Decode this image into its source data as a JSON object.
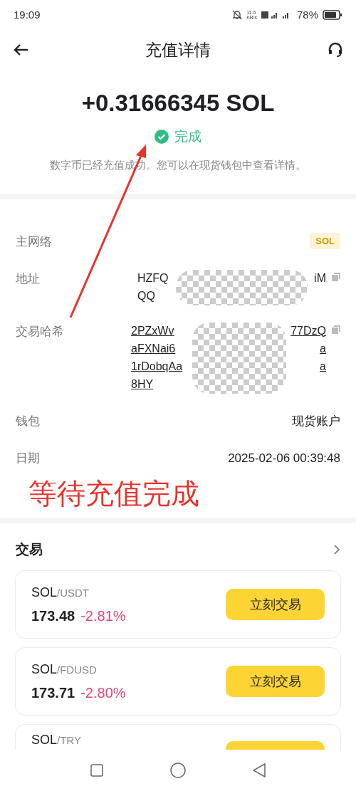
{
  "status_bar": {
    "time": "19:09",
    "net_speed": "11.6",
    "net_unit": "KB/s",
    "battery": "78%"
  },
  "header": {
    "title": "充值详情"
  },
  "summary": {
    "amount": "+0.31666345 SOL",
    "status": "完成",
    "description": "数字币已经充值成功。您可以在现货钱包中查看详情。"
  },
  "details": [
    {
      "kind": "badge",
      "label": "主网络",
      "value": "SOL"
    },
    {
      "kind": "redacted",
      "label": "地址",
      "underlined": false,
      "copyable": true,
      "lines": [
        {
          "start": "HZFQ",
          "end": "iM"
        },
        {
          "start": "QQ"
        }
      ]
    },
    {
      "kind": "redacted",
      "label": "交易哈希",
      "underlined": true,
      "copyable": true,
      "lines": [
        {
          "start": "2PZxWv",
          "end": "77DzQ"
        },
        {
          "start": "aFXNai6",
          "end": "a"
        },
        {
          "start": "1rDobqAa",
          "end": "a"
        },
        {
          "start": "8HY"
        }
      ]
    },
    {
      "kind": "text",
      "label": "钱包",
      "value": "现货账户"
    },
    {
      "kind": "text",
      "label": "日期",
      "value": "2025-02-06 00:39:48"
    }
  ],
  "annotation": {
    "text": "等待充值完成",
    "color": "#e8322c"
  },
  "trade": {
    "title": "交易",
    "pairs": [
      {
        "base": "SOL",
        "quote": "/USDT",
        "price": "173.48",
        "change": "-2.81%",
        "button": "立刻交易"
      },
      {
        "base": "SOL",
        "quote": "/FDUSD",
        "price": "173.71",
        "change": "-2.80%",
        "button": "立刻交易"
      },
      {
        "base": "SOL",
        "quote": "/TRY"
      }
    ]
  }
}
